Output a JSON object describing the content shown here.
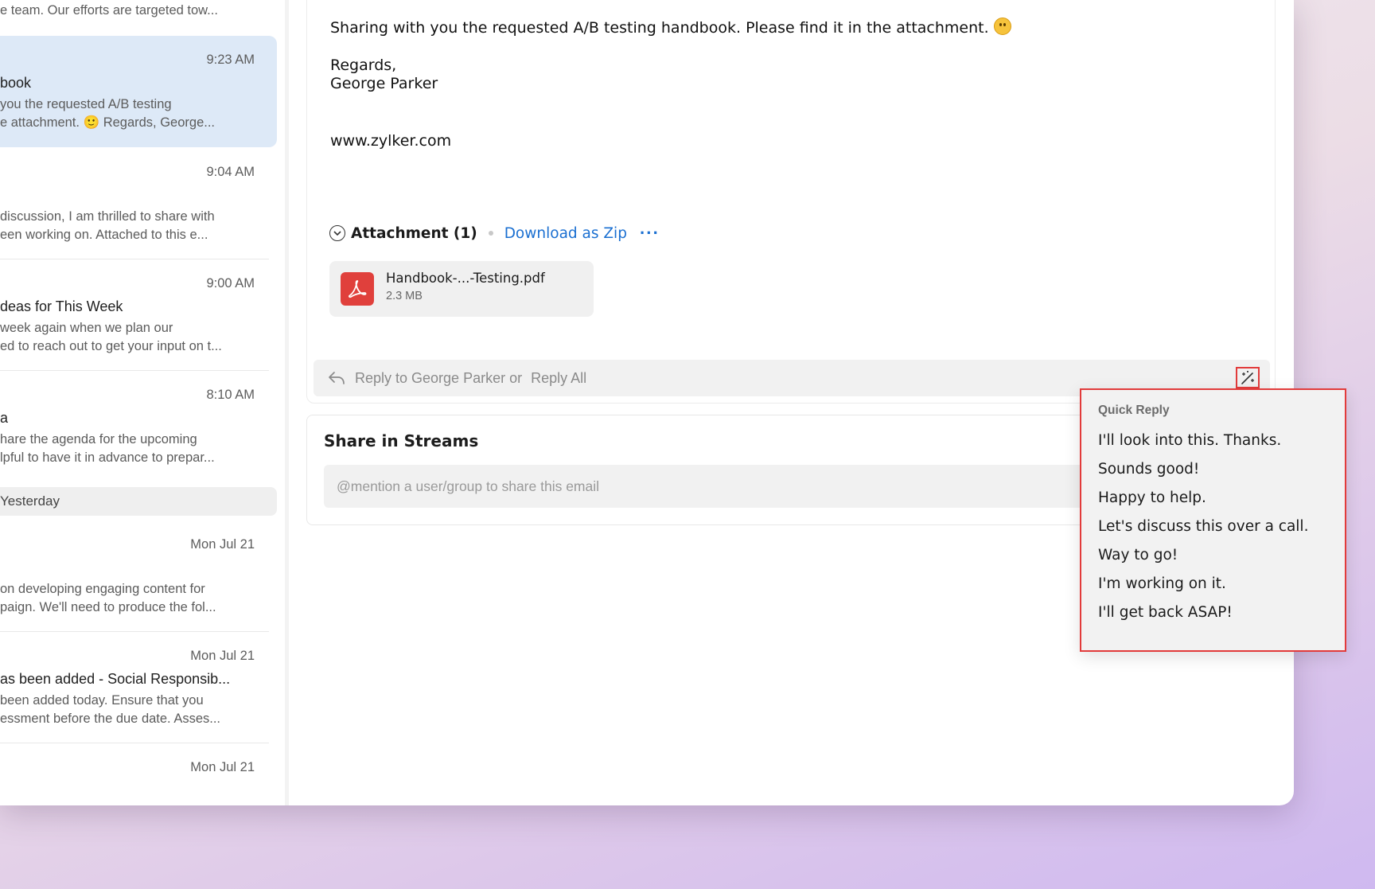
{
  "mail_list": {
    "items": [
      {
        "time": "",
        "subject": "",
        "preview1": "e team. Our efforts are targeted tow...",
        "preview2": ""
      },
      {
        "time": "9:23 AM",
        "subject": "book",
        "preview1": "you the requested A/B testing",
        "preview2": "e attachment. 🙂 Regards, George..."
      },
      {
        "time": "9:04 AM",
        "subject": "",
        "preview1": "discussion, I am thrilled to share with",
        "preview2": "een working on. Attached to this e..."
      },
      {
        "time": "9:00 AM",
        "subject": "deas for This Week",
        "preview1": " week again when we plan our",
        "preview2": "ed to reach out to get your input on t..."
      },
      {
        "time": "8:10 AM",
        "subject": "a",
        "preview1": "hare the agenda for the upcoming",
        "preview2": "lpful to have it in advance to prepar..."
      },
      {
        "time": "Mon Jul 21",
        "subject": "",
        "preview1": "on developing engaging content for",
        "preview2": "paign. We'll need to produce the fol..."
      },
      {
        "time": "Mon Jul 21",
        "subject": "as been added - Social Responsib...",
        "preview1": "been added today. Ensure that you",
        "preview2": "essment before the due date. Asses..."
      },
      {
        "time": "Mon Jul 21",
        "subject": "",
        "preview1": "",
        "preview2": ""
      }
    ],
    "group_header": "Yesterday"
  },
  "email": {
    "body_line1": "Sharing with you the requested A/B testing handbook. Please find it in the attachment.",
    "regards": "Regards,",
    "signature_name": "George Parker",
    "website": "www.zylker.com",
    "attachment_title": "Attachment (1)",
    "download_zip": "Download as Zip",
    "more": "···",
    "file": {
      "name": "Handbook-...-Testing.pdf",
      "size": "2.3 MB"
    },
    "reply_to": "Reply to George Parker or",
    "reply_all": "Reply All"
  },
  "streams": {
    "title": "Share in Streams",
    "placeholder": "@mention a user/group to share this email"
  },
  "quick_reply": {
    "heading": "Quick Reply",
    "options": [
      "I'll look into this. Thanks.",
      "Sounds good!",
      "Happy to help.",
      "Let's discuss this over a call.",
      "Way to go!",
      "I'm working on it.",
      "I'll get back ASAP!"
    ]
  },
  "colors": {
    "accent": "#1a6fd1",
    "highlight": "#e23b3b",
    "selected_bg": "#dde9f7",
    "pdf": "#e0403c"
  }
}
